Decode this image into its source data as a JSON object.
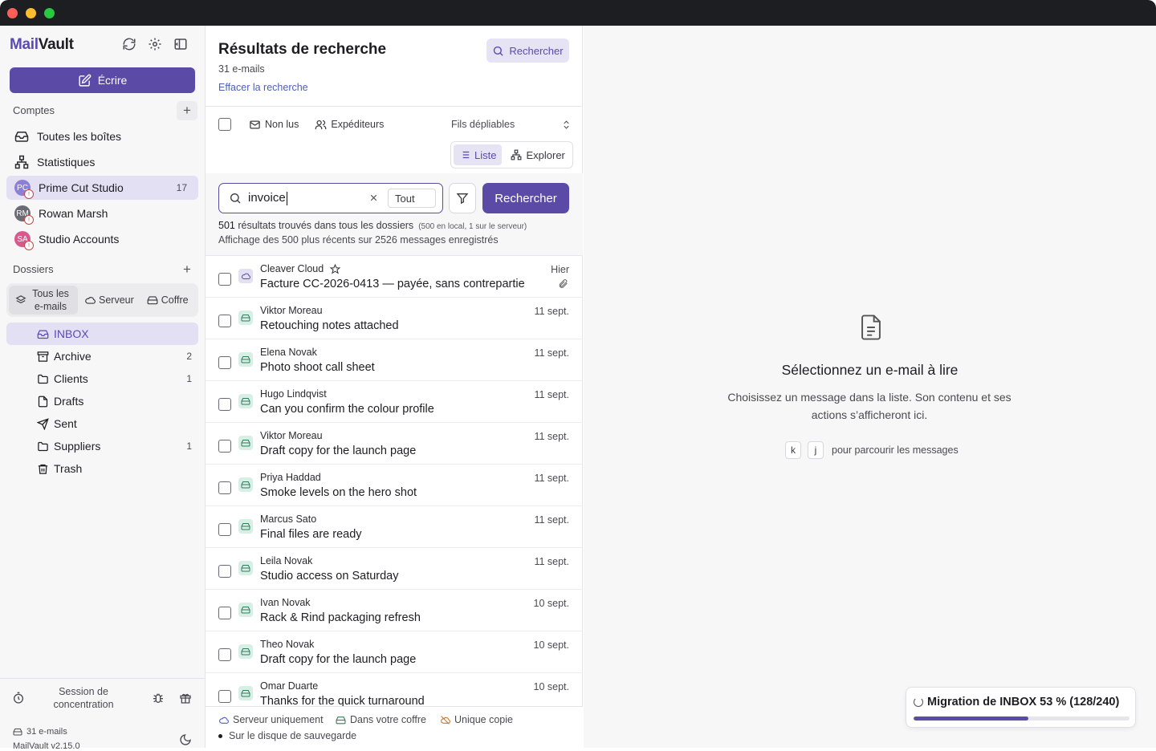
{
  "app": {
    "brand_part1": "Mail",
    "brand_part2": "Vault"
  },
  "sidebar": {
    "compose_label": "Écrire",
    "accounts_header": "Comptes",
    "items": [
      {
        "label": "Toutes les boîtes",
        "icon": "inbox-icon"
      },
      {
        "label": "Statistiques",
        "icon": "stats-icon"
      }
    ],
    "accounts": [
      {
        "label": "Prime Cut Studio",
        "initials": "PC",
        "count": "17",
        "color": "#8b7fd6",
        "active": true
      },
      {
        "label": "Rowan Marsh",
        "initials": "RM",
        "count": "",
        "color": "#6b6b75",
        "active": false
      },
      {
        "label": "Studio Accounts",
        "initials": "SA",
        "count": "",
        "color": "#d65a8e",
        "active": false
      }
    ],
    "folders_header": "Dossiers",
    "scope_options": [
      "Tous les\ne-mails",
      "Serveur",
      "Coffre"
    ],
    "scope_all": "Tous les e-mails",
    "scope_server": "Serveur",
    "scope_vault": "Coffre",
    "folders": [
      {
        "label": "INBOX",
        "count": "",
        "icon": "inbox-icon"
      },
      {
        "label": "Archive",
        "count": "2",
        "icon": "archive-icon"
      },
      {
        "label": "Clients",
        "count": "1",
        "icon": "folder-icon"
      },
      {
        "label": "Drafts",
        "count": "",
        "icon": "file-icon"
      },
      {
        "label": "Sent",
        "count": "",
        "icon": "send-icon"
      },
      {
        "label": "Suppliers",
        "count": "1",
        "icon": "folder-icon"
      },
      {
        "label": "Trash",
        "count": "",
        "icon": "trash-icon"
      }
    ],
    "focus_session": "Session de concentration",
    "footer_count": "31 e-mails",
    "version": "MailVault v2.15.0"
  },
  "results": {
    "title": "Résultats de recherche",
    "count": "31 e-mails",
    "clear": "Effacer la recherche",
    "search_button": "Rechercher",
    "toolbar": {
      "unread": "Non lus",
      "senders": "Expéditeurs",
      "threads": "Fils dépliables",
      "view_list": "Liste",
      "view_explore": "Explorer"
    },
    "search": {
      "query": "invoice",
      "scope": "Tout",
      "submit": "Rechercher",
      "stats_count": "501",
      "stats_text": " résultats trouvés dans tous les dossiers",
      "stats_detail": "(500 en local, 1 sur le serveur)",
      "stats_line2": "Affichage des 500 plus récents sur 2526 messages enregistrés"
    },
    "emails": [
      {
        "sender": "Cleaver Cloud",
        "subject": "Facture CC-2026-0413 — payée, sans contrepartie",
        "date": "Hier",
        "source": "cloud",
        "starred": true,
        "attachment": true
      },
      {
        "sender": "Viktor Moreau",
        "subject": "Retouching notes attached",
        "date": "11 sept.",
        "source": "vault"
      },
      {
        "sender": "Elena Novak",
        "subject": "Photo shoot call sheet",
        "date": "11 sept.",
        "source": "vault"
      },
      {
        "sender": "Hugo Lindqvist",
        "subject": "Can you confirm the colour profile",
        "date": "11 sept.",
        "source": "vault"
      },
      {
        "sender": "Viktor Moreau",
        "subject": "Draft copy for the launch page",
        "date": "11 sept.",
        "source": "vault"
      },
      {
        "sender": "Priya Haddad",
        "subject": "Smoke levels on the hero shot",
        "date": "11 sept.",
        "source": "vault"
      },
      {
        "sender": "Marcus Sato",
        "subject": "Final files are ready",
        "date": "11 sept.",
        "source": "vault"
      },
      {
        "sender": "Leila Novak",
        "subject": "Studio access on Saturday",
        "date": "11 sept.",
        "source": "vault"
      },
      {
        "sender": "Ivan Novak",
        "subject": "Rack & Rind packaging refresh",
        "date": "10 sept.",
        "source": "vault"
      },
      {
        "sender": "Theo Novak",
        "subject": "Draft copy for the launch page",
        "date": "10 sept.",
        "source": "vault"
      },
      {
        "sender": "Omar Duarte",
        "subject": "Thanks for the quick turnaround",
        "date": "10 sept.",
        "source": "vault"
      }
    ],
    "legend": {
      "server_only": "Serveur uniquement",
      "in_vault": "Dans votre coffre",
      "single_copy": "Unique copie",
      "on_backup": "Sur le disque de sauvegarde"
    }
  },
  "reader": {
    "empty_title": "Sélectionnez un e-mail à lire",
    "empty_sub": "Choisissez un message dans la liste. Son contenu et ses actions s’afficheront ici.",
    "key_k": "k",
    "key_j": "j",
    "key_hint": "pour parcourir les messages"
  },
  "migration": {
    "label": "Migration de INBOX 53 % (128/240)",
    "progress": 0.53
  },
  "colors": {
    "accent": "#5b4ba7",
    "accent_light": "#e3e0f3"
  }
}
